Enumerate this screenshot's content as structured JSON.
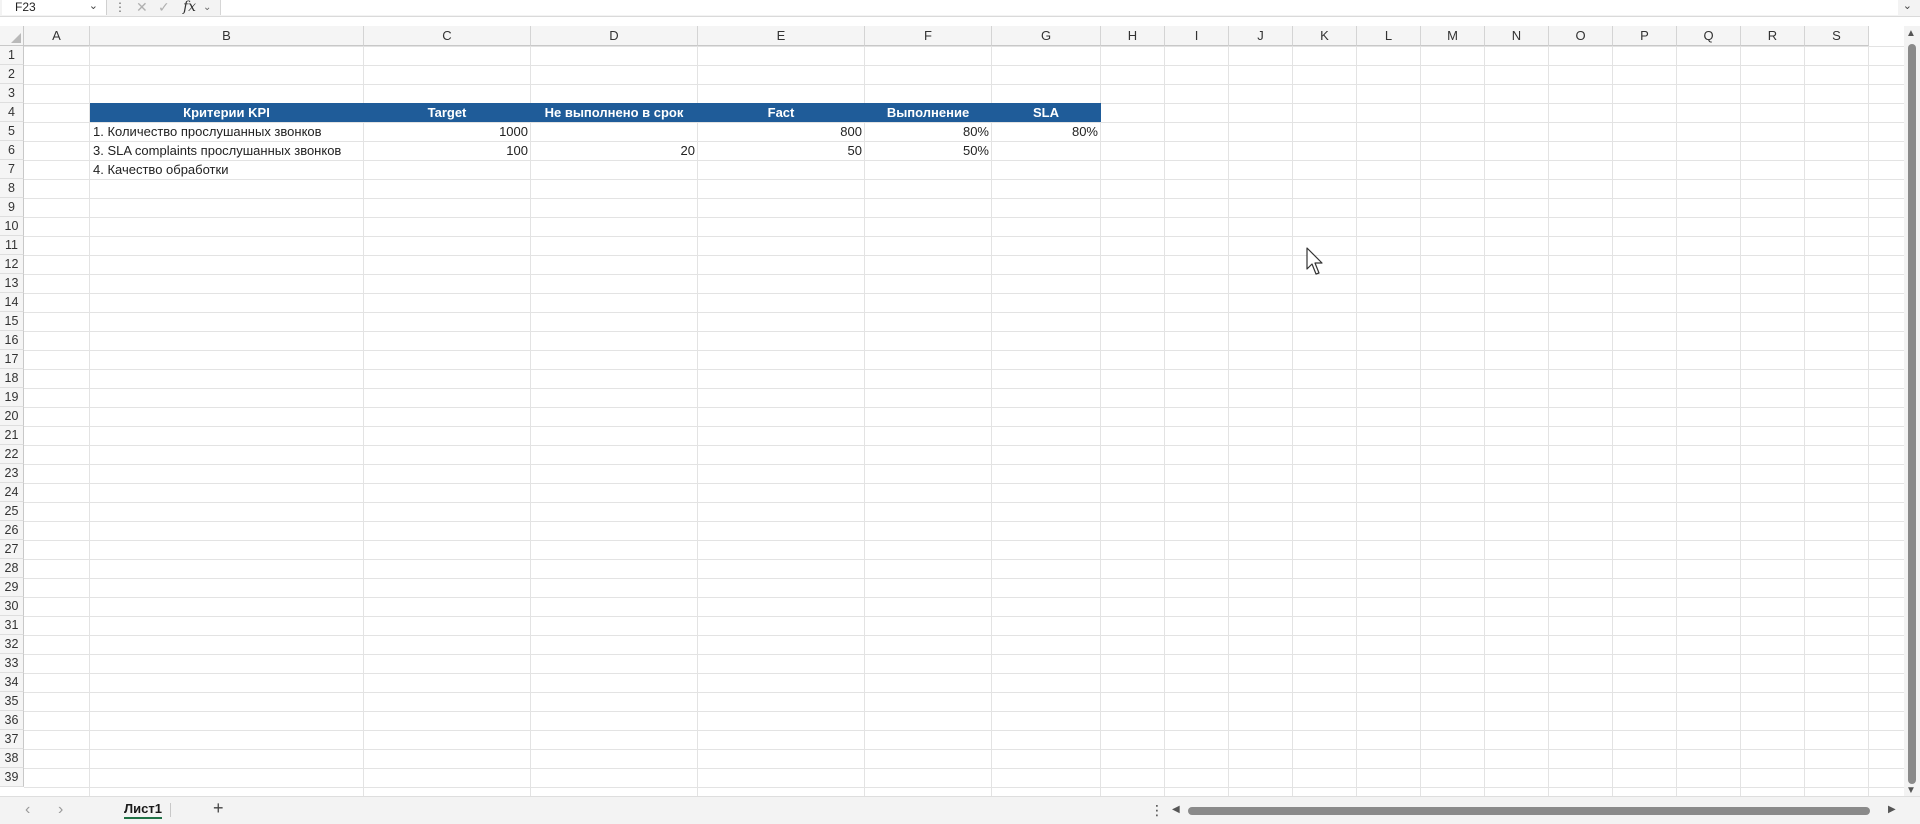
{
  "formula_bar": {
    "name_box": "F23",
    "fx_label": "fx",
    "formula": ""
  },
  "columns": [
    "A",
    "B",
    "C",
    "D",
    "E",
    "F",
    "G",
    "H",
    "I",
    "J",
    "K",
    "L",
    "M",
    "N",
    "O",
    "P",
    "Q",
    "R",
    "S"
  ],
  "rows": [
    "1",
    "2",
    "3",
    "4",
    "5",
    "6",
    "7",
    "8",
    "9",
    "10",
    "11",
    "12",
    "13",
    "14",
    "15",
    "16",
    "17",
    "18",
    "19",
    "20",
    "21",
    "22",
    "23",
    "24",
    "25",
    "26",
    "27",
    "28",
    "29",
    "30",
    "31",
    "32",
    "33",
    "34",
    "35",
    "36",
    "37",
    "38",
    "39"
  ],
  "kpi_table": {
    "header_color": "#1f5c99",
    "headers": [
      "Критерии KPI",
      "Target",
      "Не выполнено в срок",
      "Fact",
      "Выполнение",
      "SLA"
    ],
    "rows": [
      {
        "kpi": "1. Количество прослушанных звонков",
        "target": "1000",
        "not_done": "",
        "fact": "800",
        "done": "80%",
        "sla": "80%"
      },
      {
        "kpi": "3. SLA complaints прослушанных звонков",
        "target": "100",
        "not_done": "20",
        "fact": "50",
        "done": "50%",
        "sla": ""
      },
      {
        "kpi": "4. Качество обработки",
        "target": "",
        "not_done": "",
        "fact": "",
        "done": "",
        "sla": ""
      }
    ]
  },
  "sheets": {
    "active": "Лист1",
    "add_label": "+"
  },
  "icons": {
    "name_box_chevron": "chevron-down-icon",
    "cancel": "close-icon",
    "enter": "check-icon",
    "cursor": "mouse-pointer-icon"
  }
}
